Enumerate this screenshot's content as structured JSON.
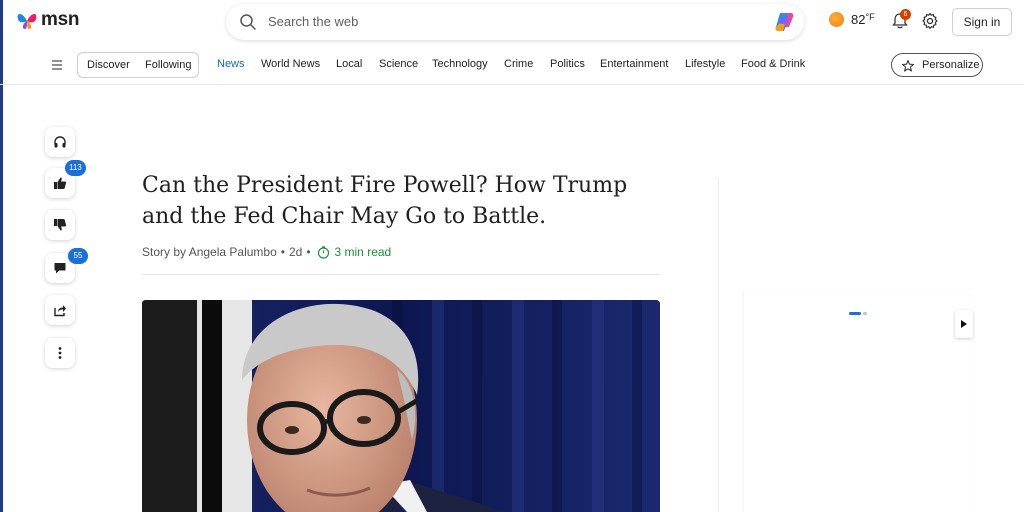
{
  "app": {
    "logo_text": "msn"
  },
  "search": {
    "placeholder": "Search the web"
  },
  "weather": {
    "temperature": "82",
    "unit": "°F"
  },
  "notifications": {
    "count": "6"
  },
  "header": {
    "signin_label": "Sign in"
  },
  "nav": {
    "segment": [
      "Discover",
      "Following"
    ],
    "items": [
      "News",
      "World News",
      "Local",
      "Science",
      "Technology",
      "Crime",
      "Politics",
      "Entertainment",
      "Lifestyle",
      "Food & Drink"
    ],
    "active": "News",
    "personalize_label": "Personalize"
  },
  "rail": {
    "likes_count": "113",
    "comments_count": "55"
  },
  "article": {
    "headline": "Can the President Fire Powell? How Trump and the Fed Chair May Go to Battle.",
    "byline_author": "Story by Angela Palumbo",
    "byline_age": "2d",
    "read_time": "3 min read"
  },
  "colors": {
    "accent": "#0f6cbd",
    "badge_blue": "#1a6fd8",
    "read_time_green": "#1d8f3a",
    "notif_red": "#d83b01"
  }
}
